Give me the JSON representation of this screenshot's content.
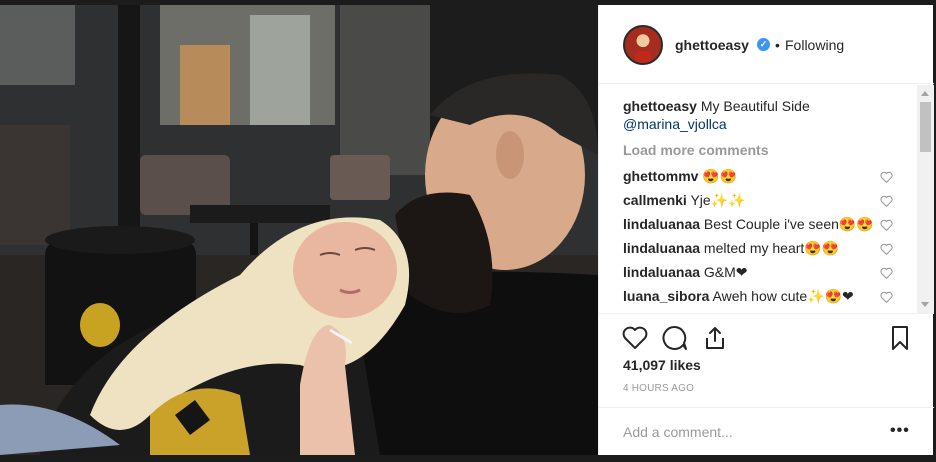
{
  "post": {
    "username": "ghettoeasy",
    "separator": "•",
    "follow_state": "Following",
    "caption_user": "ghettoeasy",
    "caption_text": "My Beautiful Side",
    "caption_mention": "@marina_vjollca",
    "load_more": "Load more comments",
    "comments": [
      {
        "user": "ghettommv",
        "text": "😍😍"
      },
      {
        "user": "callmenki",
        "text": "Yje✨✨"
      },
      {
        "user": "lindaluanaa",
        "text": "Best Couple i've seen😍😍"
      },
      {
        "user": "lindaluanaa",
        "text": "melted my heart😍😍"
      },
      {
        "user": "lindaluanaa",
        "text": "G&M❤"
      },
      {
        "user": "luana_sibora",
        "text": "Aweh how cute✨😍❤"
      }
    ],
    "likes": "41,097 likes",
    "time": "4 HOURS AGO",
    "add_comment_placeholder": "Add a comment...",
    "more": "•••"
  },
  "colors": {
    "verified": "#3897f0",
    "mention": "#003569",
    "muted": "#999999",
    "text": "#262626"
  },
  "icons": {
    "like": "heart-icon",
    "comment": "comment-bubble-icon",
    "share": "share-icon",
    "save": "bookmark-icon",
    "verified": "verified-badge-icon"
  }
}
